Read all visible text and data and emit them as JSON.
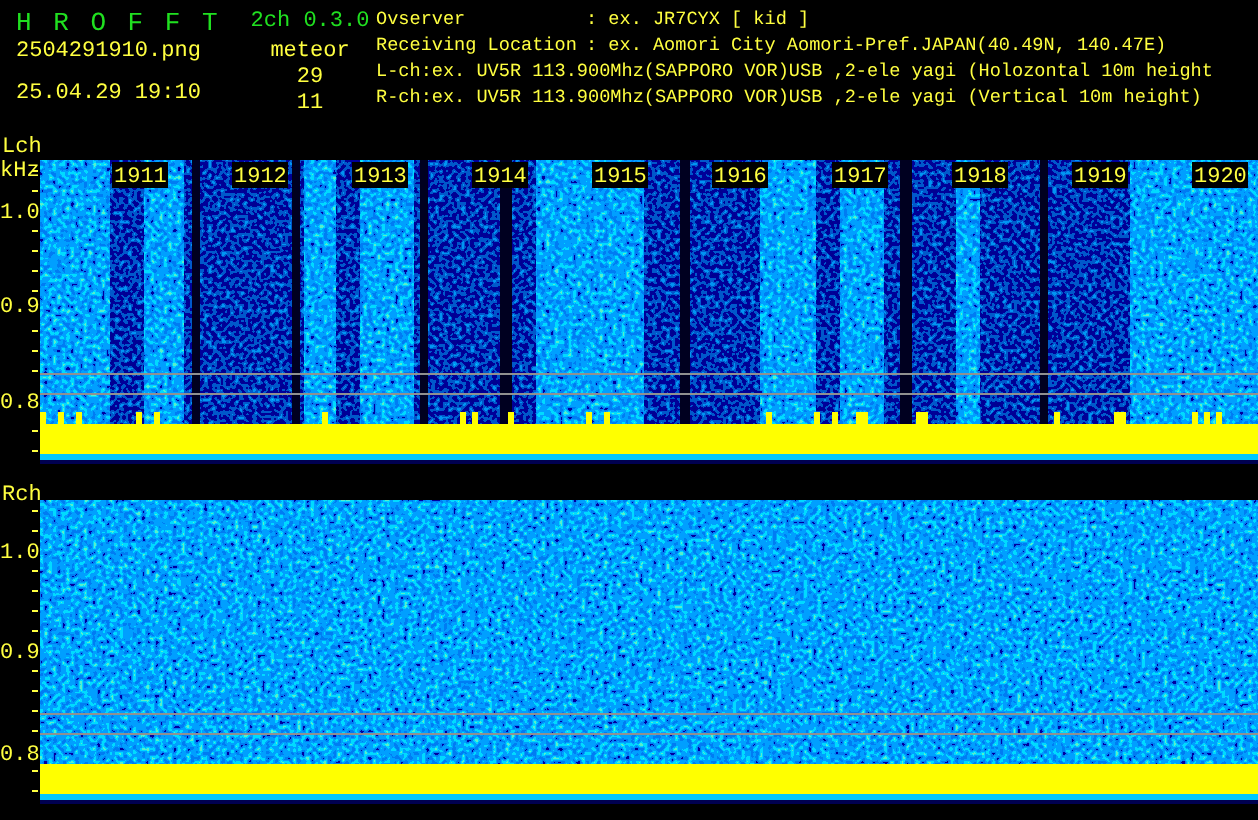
{
  "app": {
    "title": "H R O F F T",
    "version": "2ch 0.3.0",
    "filename": "2504291910.png",
    "datetime": "25.04.29 19:10",
    "count_label": "meteor",
    "counts": [
      "29",
      "11"
    ]
  },
  "observer": {
    "label": "Ovserver",
    "value": ": ex. JR7CYX [ kid ]"
  },
  "location": {
    "label": "Receiving Location",
    "value": ": ex. Aomori City Aomori-Pref.JAPAN(40.49N, 140.47E)"
  },
  "channel_lines": [
    "L-ch:ex. UV5R 113.900Mhz(SAPPORO VOR)USB ,2-ele yagi (Holozontal 10m height",
    "R-ch:ex. UV5R 113.900Mhz(SAPPORO VOR)USB ,2-ele yagi (Vertical 10m height)"
  ],
  "panels": [
    {
      "label": "Lch",
      "unit": "kHz",
      "time_labels": [
        "1911",
        "1912",
        "1913",
        "1914",
        "1915",
        "1916",
        "1917",
        "1918",
        "1919",
        "1920"
      ],
      "y_labels": [
        "1.0",
        "0.9",
        "0.8"
      ]
    },
    {
      "label": "Rch",
      "y_labels": [
        "1.0",
        "0.9",
        "0.8"
      ]
    }
  ]
}
